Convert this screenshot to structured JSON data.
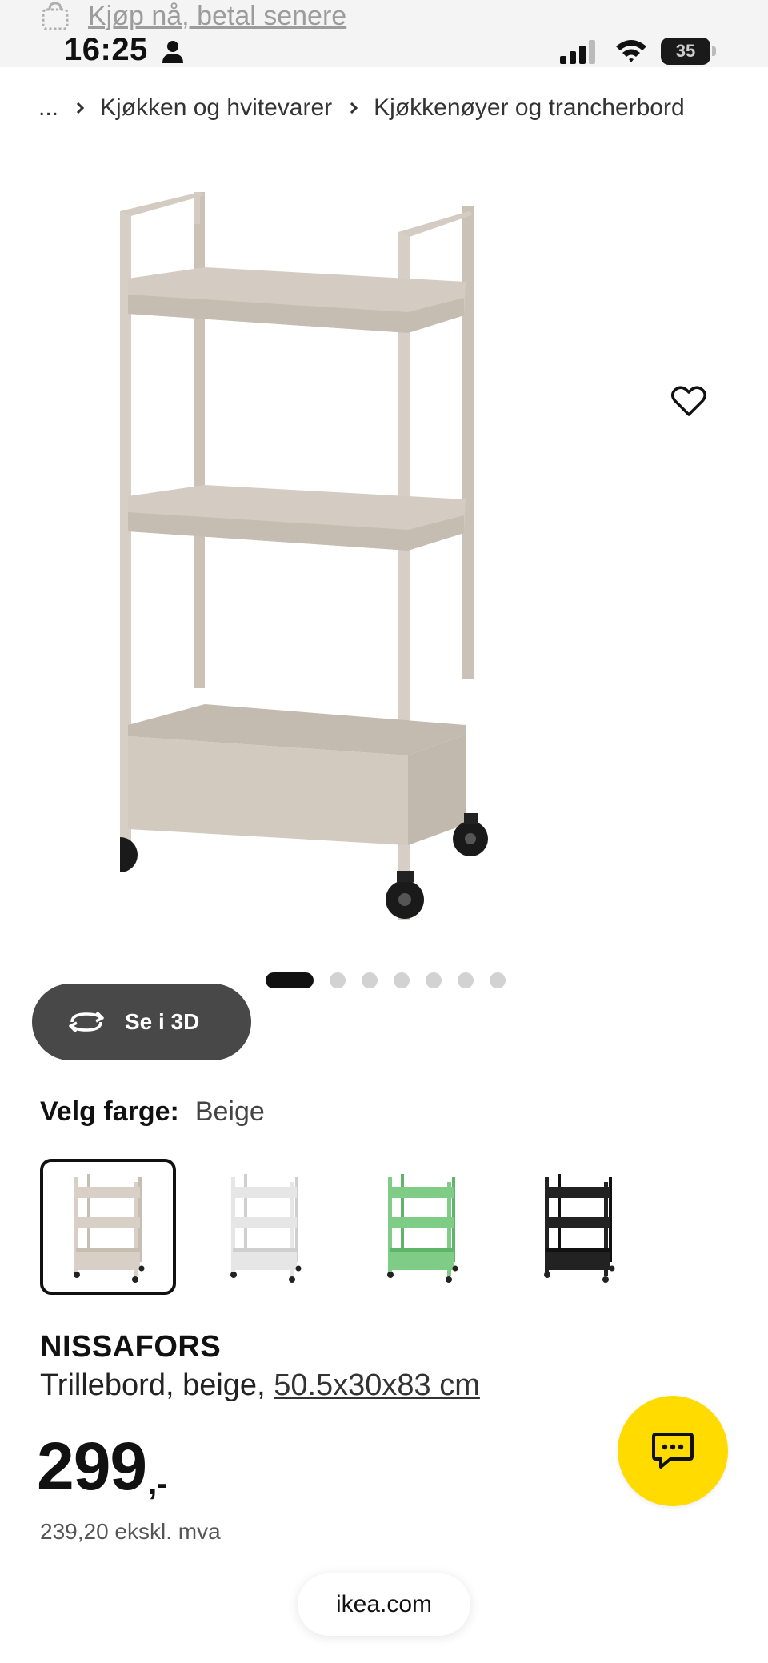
{
  "status_bar": {
    "time": "16:25",
    "battery": "35",
    "icons": [
      "person-icon",
      "cellular-signal-icon",
      "wifi-icon",
      "battery-icon"
    ]
  },
  "banner": {
    "text": "Kjøp nå, betal senere",
    "icon": "shopping-bag-icon"
  },
  "breadcrumb": {
    "ellipsis": "...",
    "items": [
      "Kjøkken og hvitevarer",
      "Kjøkkenøyer og trancherbord"
    ]
  },
  "gallery": {
    "view_3d_label": "Se i 3D",
    "total_images": 7,
    "current_index": 1
  },
  "color": {
    "label": "Velg farge:",
    "selected": "Beige",
    "options": [
      {
        "name": "Beige",
        "frame": "#d8d0c6",
        "shade": "#c7beb3"
      },
      {
        "name": "White",
        "frame": "#e6e6e6",
        "shade": "#cfcfcf"
      },
      {
        "name": "Green",
        "frame": "#7fcc86",
        "shade": "#5fb56a"
      },
      {
        "name": "Black",
        "frame": "#222222",
        "shade": "#111111"
      }
    ]
  },
  "product": {
    "name": "NISSAFORS",
    "description": "Trillebord, beige, ",
    "dimensions": "50.5x30x83 cm",
    "price": "299",
    "price_suffix": ",-",
    "price_ex_vat": "239,20 ekskl. mva"
  },
  "footer": {
    "url": "ikea.com"
  },
  "colors": {
    "accent_yellow": "#ffdb00",
    "dark_pill": "#484848"
  }
}
